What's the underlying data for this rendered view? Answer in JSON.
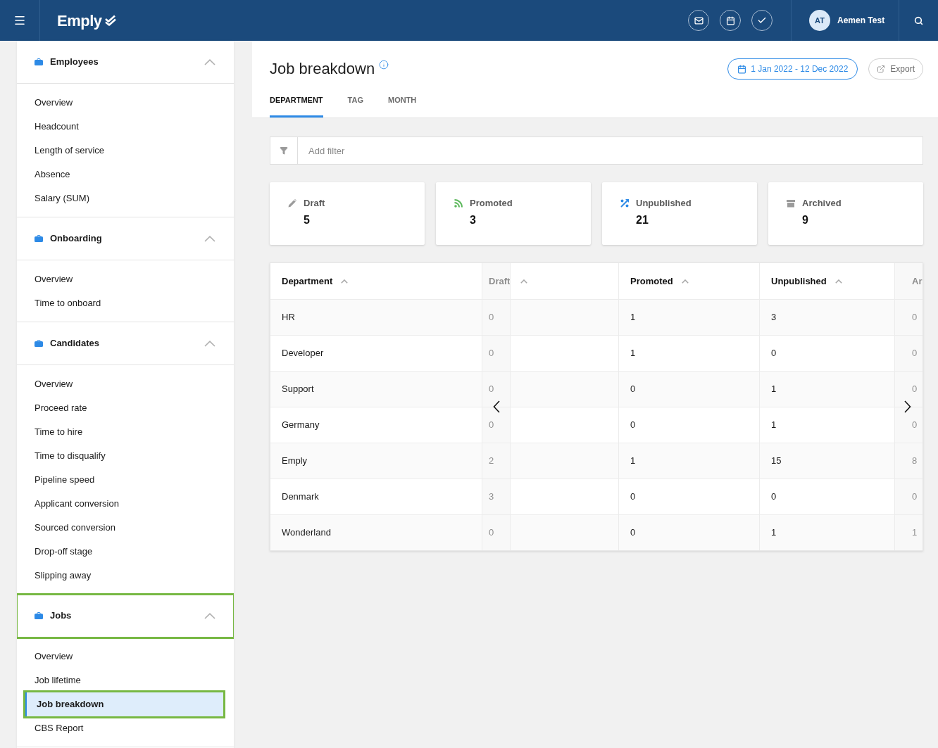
{
  "topbar": {
    "logo": "Emply",
    "user": {
      "initials": "AT",
      "name": "Aemen Test"
    }
  },
  "sidebar": {
    "sections": [
      {
        "title": "Employees",
        "expanded": true,
        "highlighted": false,
        "items": [
          {
            "label": "Overview",
            "selected": false,
            "highlighted": false
          },
          {
            "label": "Headcount",
            "selected": false,
            "highlighted": false
          },
          {
            "label": "Length of service",
            "selected": false,
            "highlighted": false
          },
          {
            "label": "Absence",
            "selected": false,
            "highlighted": false
          },
          {
            "label": "Salary (SUM)",
            "selected": false,
            "highlighted": false
          }
        ]
      },
      {
        "title": "Onboarding",
        "expanded": true,
        "highlighted": false,
        "items": [
          {
            "label": "Overview",
            "selected": false,
            "highlighted": false
          },
          {
            "label": "Time to onboard",
            "selected": false,
            "highlighted": false
          }
        ]
      },
      {
        "title": "Candidates",
        "expanded": true,
        "highlighted": false,
        "items": [
          {
            "label": "Overview",
            "selected": false,
            "highlighted": false
          },
          {
            "label": "Proceed rate",
            "selected": false,
            "highlighted": false
          },
          {
            "label": "Time to hire",
            "selected": false,
            "highlighted": false
          },
          {
            "label": "Time to disqualify",
            "selected": false,
            "highlighted": false
          },
          {
            "label": "Pipeline speed",
            "selected": false,
            "highlighted": false
          },
          {
            "label": "Applicant conversion",
            "selected": false,
            "highlighted": false
          },
          {
            "label": "Sourced conversion",
            "selected": false,
            "highlighted": false
          },
          {
            "label": "Drop-off stage",
            "selected": false,
            "highlighted": false
          },
          {
            "label": "Slipping away",
            "selected": false,
            "highlighted": false
          }
        ]
      },
      {
        "title": "Jobs",
        "expanded": true,
        "highlighted": true,
        "items": [
          {
            "label": "Overview",
            "selected": false,
            "highlighted": false
          },
          {
            "label": "Job lifetime",
            "selected": false,
            "highlighted": false
          },
          {
            "label": "Job breakdown",
            "selected": true,
            "highlighted": true
          },
          {
            "label": "CBS Report",
            "selected": false,
            "highlighted": false
          }
        ]
      }
    ]
  },
  "page": {
    "title": "Job breakdown",
    "date_range": "1 Jan 2022 - 12 Dec 2022",
    "export": "Export",
    "tabs": [
      {
        "label": "DEPARTMENT",
        "selected": true
      },
      {
        "label": "TAG",
        "selected": false
      },
      {
        "label": "MONTH",
        "selected": false
      }
    ]
  },
  "filter": {
    "placeholder": "Add filter"
  },
  "stats": [
    {
      "kind": "draft",
      "label": "Draft",
      "value": "5",
      "color": "#9b9b9b"
    },
    {
      "kind": "promoted",
      "label": "Promoted",
      "value": "3",
      "color": "#5cb85c"
    },
    {
      "kind": "unpublished",
      "label": "Unpublished",
      "value": "21",
      "color": "#2d8ae6"
    },
    {
      "kind": "archived",
      "label": "Archived",
      "value": "9",
      "color": "#9b9b9b"
    }
  ],
  "table": {
    "columns": [
      {
        "label": "Department",
        "kind": "data",
        "sortable": true
      },
      {
        "label": "Draft",
        "kind": "peek_left",
        "sortable": true
      },
      {
        "label": "Promoted",
        "kind": "data",
        "sortable": true
      },
      {
        "label": "Unpublished",
        "kind": "data",
        "sortable": true
      },
      {
        "label": "Ar",
        "kind": "peek_right",
        "sortable": false
      }
    ],
    "rows": [
      [
        "HR",
        "0",
        "1",
        "3",
        "0"
      ],
      [
        "Developer",
        "0",
        "1",
        "0",
        "0"
      ],
      [
        "Support",
        "0",
        "0",
        "1",
        "0"
      ],
      [
        "Germany",
        "0",
        "0",
        "1",
        "0"
      ],
      [
        "Emply",
        "2",
        "1",
        "15",
        "8"
      ],
      [
        "Denmark",
        "3",
        "0",
        "0",
        "0"
      ],
      [
        "Wonderland",
        "0",
        "0",
        "1",
        "1"
      ]
    ]
  }
}
